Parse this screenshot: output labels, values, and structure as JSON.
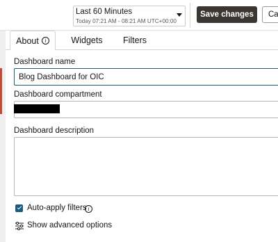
{
  "toolbar": {
    "time_label": "Last 60 Minutes",
    "time_range": "Today 07:21 AM - 08:21 AM UTC+00:00",
    "save_label": "Save changes",
    "cancel_label": "Ca"
  },
  "tabs": [
    {
      "label": "About",
      "active": true,
      "icon": "info-icon"
    },
    {
      "label": "Widgets",
      "active": false
    },
    {
      "label": "Filters",
      "active": false
    }
  ],
  "form": {
    "name_label": "Dashboard name",
    "name_value": "Blog Dashboard for OIC",
    "compartment_label": "Dashboard compartment",
    "description_label": "Dashboard description",
    "description_value": "",
    "auto_apply_label": "Auto-apply filters",
    "auto_apply_checked": true,
    "advanced_label": "Show advanced options"
  },
  "colors": {
    "primary_button": "#3a3632",
    "accent": "#1b5a7a",
    "left_accent": "#c74634"
  }
}
